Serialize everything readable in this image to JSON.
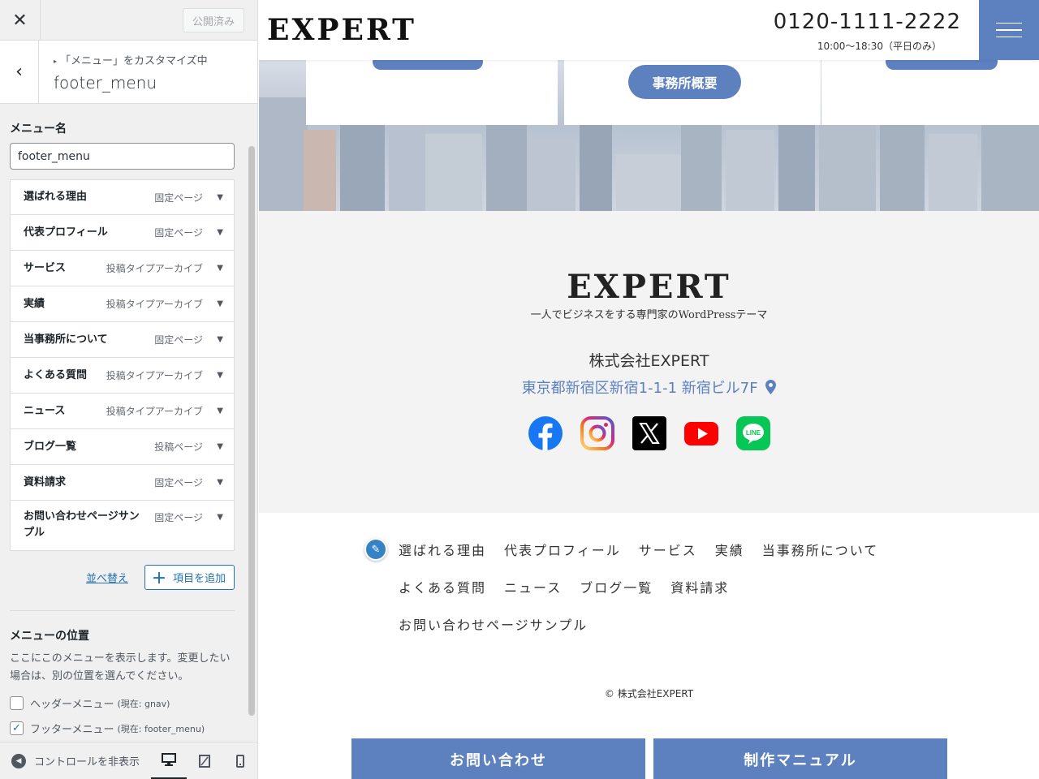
{
  "customizer": {
    "close_glyph": "✕",
    "publish_label": "公開済み",
    "back_glyph": "‹",
    "breadcrumb": "「メニュー」をカスタマイズ中",
    "section_title": "footer_menu",
    "menu_name_label": "メニュー名",
    "menu_name_value": "footer_menu",
    "menu_items": [
      {
        "title": "選ばれる理由",
        "type": "固定ページ"
      },
      {
        "title": "代表プロフィール",
        "type": "固定ページ"
      },
      {
        "title": "サービス",
        "type": "投稿タイプアーカイブ"
      },
      {
        "title": "実績",
        "type": "投稿タイプアーカイブ"
      },
      {
        "title": "当事務所について",
        "type": "固定ページ"
      },
      {
        "title": "よくある質問",
        "type": "投稿タイプアーカイブ"
      },
      {
        "title": "ニュース",
        "type": "投稿タイプアーカイブ"
      },
      {
        "title": "ブログ一覧",
        "type": "投稿ページ"
      },
      {
        "title": "資料請求",
        "type": "固定ページ"
      },
      {
        "title": "お問い合わせページサンプル",
        "type": "固定ページ"
      }
    ],
    "reorder_label": "並べ替え",
    "add_item_label": "項目を追加",
    "location_label": "メニューの位置",
    "location_desc": "ここにこのメニューを表示します。変更したい場合は、別の位置を選んでください。",
    "locations": [
      {
        "label": "ヘッダーメニュー",
        "current": "(現在: gnav)",
        "checked": false
      },
      {
        "label": "フッターメニュー",
        "current": "(現在: footer_menu)",
        "checked": true
      }
    ],
    "collapse_label": "コントロールを非表示",
    "active_device": "desktop"
  },
  "site": {
    "logo": "EXPERT",
    "phone": "0120-1111-2222",
    "hours": "10:00〜18:30（平日のみ）",
    "card_button": "事務所概要",
    "footer_logo": "EXPERT",
    "tagline": "一人でビジネスをする専門家のWordPressテーマ",
    "company": "株式会社EXPERT",
    "address": "東京都新宿区新宿1-1-1 新宿ビル7F",
    "social": [
      "facebook-icon",
      "instagram-icon",
      "x-icon",
      "youtube-icon",
      "line-icon"
    ],
    "footer_links": [
      "選ばれる理由",
      "代表プロフィール",
      "サービス",
      "実績",
      "当事務所について",
      "よくある質問",
      "ニュース",
      "ブログ一覧",
      "資料請求",
      "お問い合わせページサンプル"
    ],
    "copyright": "© 株式会社EXPERT",
    "cta_contact": "お問い合わせ",
    "cta_manual": "制作マニュアル",
    "accent_color": "#5d80bf"
  }
}
